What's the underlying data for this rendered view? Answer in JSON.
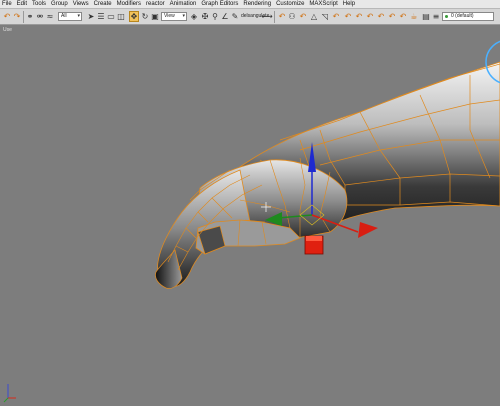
{
  "menu": [
    "File",
    "Edit",
    "Tools",
    "Group",
    "Views",
    "Create",
    "Modifiers",
    "reactor",
    "Animation",
    "Graph Editors",
    "Rendering",
    "Customize",
    "MAXScript",
    "Help"
  ],
  "toolbar": {
    "selection_filter": "All",
    "reference_coord": "View",
    "named_selection": "delsangulate",
    "layer": "0 (default)"
  },
  "viewport": {
    "label": "Use"
  },
  "icons": {
    "undo": "undo-icon",
    "redo": "redo-icon",
    "link": "link-icon",
    "select": "select-arrow-icon",
    "move": "move-icon",
    "rotate": "rotate-icon",
    "scale": "scale-icon",
    "snap": "snap-icon",
    "render": "teapot-icon"
  },
  "colors": {
    "viewport_bg": "#7d7d7d",
    "wire": "#e08a1e",
    "axis_x": "#d81e12",
    "axis_y": "#1e8a1e",
    "axis_z": "#1e2ad0",
    "gizmo_box": "#e02010"
  }
}
